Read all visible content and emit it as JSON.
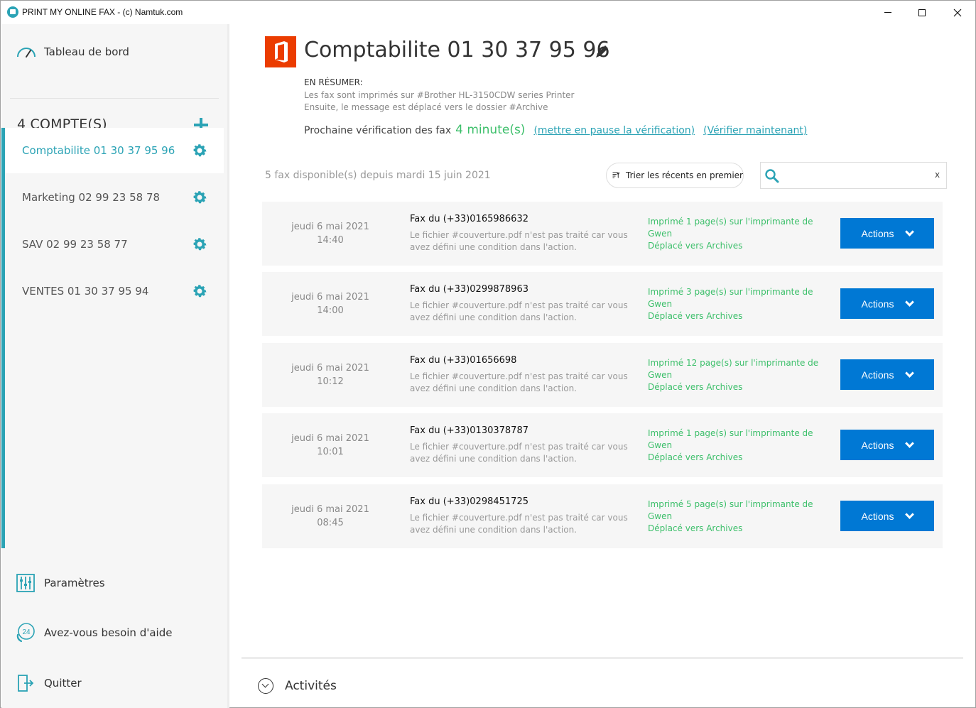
{
  "window": {
    "title": "PRINT MY ONLINE FAX - (c) Namtuk.com"
  },
  "colors": {
    "accent": "#2ba3b5",
    "button": "#0078d4",
    "success": "#3cbf6a",
    "office_logo": "#eb3c00"
  },
  "sidebar": {
    "dashboard_label": "Tableau de bord",
    "accounts_title": "4 COMPTE(S)",
    "accounts": [
      {
        "label": "Comptabilite 01 30 37 95 96",
        "active": true
      },
      {
        "label": "Marketing 02 99 23 58 78",
        "active": false
      },
      {
        "label": "SAV 02 99 23 58 77",
        "active": false
      },
      {
        "label": "VENTES 01 30 37 95 94",
        "active": false
      }
    ],
    "settings_label": "Paramètres",
    "help_label": "Avez-vous besoin d'aide",
    "help_badge": "24",
    "quit_label": "Quitter"
  },
  "main": {
    "title": "Comptabilite 01 30 37 95 96",
    "summary_label": "EN RÉSUMER:",
    "summary_lines": [
      "Les fax sont imprimés sur #Brother HL-3150CDW series Printer",
      "Ensuite, le message est déplacé vers le dossier #Archive"
    ],
    "next_check_text": "Prochaine vérification des fax",
    "next_check_minutes": "4 minute(s)",
    "pause_link": "(mettre en pause la vérification)",
    "check_now_link": "(Vérifier maintenant)",
    "fax_count": "5 fax disponible(s) depuis mardi 15 juin 2021",
    "sort_label": "Trier les récents en premier",
    "search_value": "",
    "search_clear": "x",
    "faxes": [
      {
        "date": "jeudi 6 mai 2021",
        "time": "14:40",
        "from": "Fax du (+33)0165986632",
        "note": "Le fichier #couverture.pdf n'est pas traité car vous avez défini une condition dans l'action.",
        "printed": "Imprimé 1 page(s) sur l'imprimante de Gwen",
        "moved": "Déplacé vers Archives",
        "action": "Actions"
      },
      {
        "date": "jeudi 6 mai 2021",
        "time": "14:00",
        "from": "Fax du (+33)0299878963",
        "note": "Le fichier #couverture.pdf n'est pas traité car vous avez défini une condition dans l'action.",
        "printed": "Imprimé 3 page(s) sur l'imprimante de Gwen",
        "moved": "Déplacé vers Archives",
        "action": "Actions"
      },
      {
        "date": "jeudi 6 mai 2021",
        "time": "10:12",
        "from": "Fax du (+33)01656698",
        "note": "Le fichier #couverture.pdf n'est pas traité car vous avez défini une condition dans l'action.",
        "printed": "Imprimé 12 page(s) sur l'imprimante de Gwen",
        "moved": "Déplacé vers Archives",
        "action": "Actions"
      },
      {
        "date": "jeudi 6 mai 2021",
        "time": "10:01",
        "from": "Fax du (+33)0130378787",
        "note": "Le fichier #couverture.pdf n'est pas traité car vous avez défini une condition dans l'action.",
        "printed": "Imprimé 1 page(s) sur l'imprimante de Gwen",
        "moved": "Déplacé vers Archives",
        "action": "Actions"
      },
      {
        "date": "jeudi 6 mai 2021",
        "time": "08:45",
        "from": "Fax du (+33)0298451725",
        "note": "Le fichier #couverture.pdf n'est pas traité car vous avez défini une condition dans l'action.",
        "printed": "Imprimé 5 page(s) sur l'imprimante de Gwen",
        "moved": "Déplacé vers Archives",
        "action": "Actions"
      }
    ],
    "activities_label": "Activités"
  }
}
